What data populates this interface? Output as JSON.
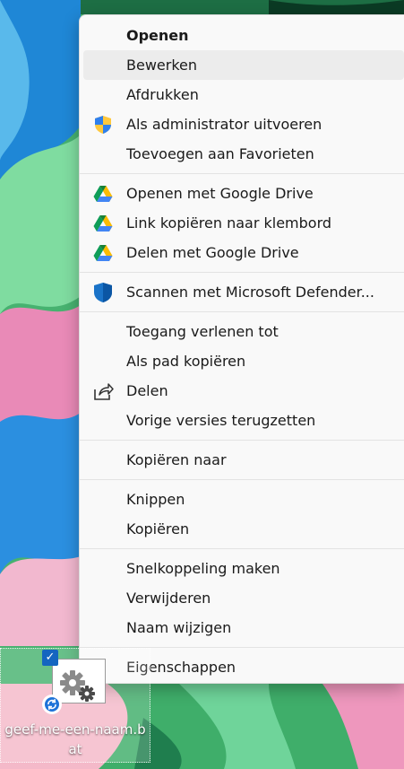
{
  "menu": {
    "group1": [
      {
        "label": "Openen",
        "icon": "",
        "bold": true
      },
      {
        "label": "Bewerken",
        "icon": "",
        "hover": true
      },
      {
        "label": "Afdrukken",
        "icon": ""
      },
      {
        "label": "Als administrator uitvoeren",
        "icon": "uac-shield-icon"
      },
      {
        "label": "Toevoegen aan Favorieten",
        "icon": ""
      }
    ],
    "group2": [
      {
        "label": "Openen met Google Drive",
        "icon": "google-drive-icon"
      },
      {
        "label": "Link kopiëren naar klembord",
        "icon": "google-drive-icon"
      },
      {
        "label": "Delen met Google Drive",
        "icon": "google-drive-icon"
      }
    ],
    "group3": [
      {
        "label": "Scannen met Microsoft Defender...",
        "icon": "defender-shield-icon"
      }
    ],
    "group4": [
      {
        "label": "Toegang verlenen tot",
        "icon": ""
      },
      {
        "label": "Als pad kopiëren",
        "icon": ""
      },
      {
        "label": "Delen",
        "icon": "share-icon"
      },
      {
        "label": "Vorige versies terugzetten",
        "icon": ""
      }
    ],
    "group5": [
      {
        "label": "Kopiëren naar",
        "icon": ""
      }
    ],
    "group6": [
      {
        "label": "Knippen",
        "icon": ""
      },
      {
        "label": "Kopiëren",
        "icon": ""
      }
    ],
    "group7": [
      {
        "label": "Snelkoppeling maken",
        "icon": ""
      },
      {
        "label": "Verwijderen",
        "icon": ""
      },
      {
        "label": "Naam wijzigen",
        "icon": ""
      }
    ],
    "group8": [
      {
        "label": "Eigenschappen",
        "icon": ""
      }
    ]
  },
  "desktop_icon": {
    "name_line1": "geef-me-een-naam.b",
    "name_line2": "at",
    "checkbox_glyph": "✓",
    "icon": "batch-file-gear-icon"
  },
  "colors": {
    "menu_bg": "#f9f9f9",
    "hover_bg": "#ececec",
    "checkbox": "#1565c0"
  }
}
